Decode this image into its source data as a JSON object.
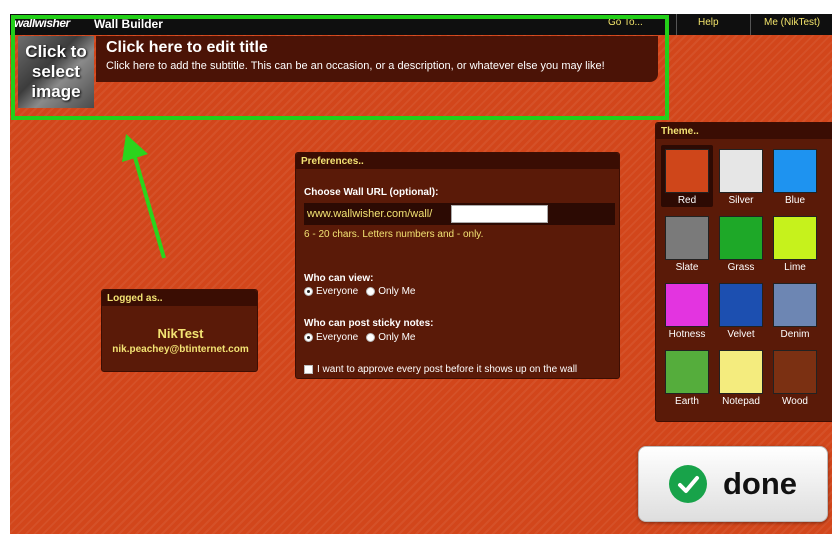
{
  "header": {
    "logo": "wallwisher",
    "app_name": "Wall Builder",
    "nav": {
      "goto": "Go To...",
      "help": "Help",
      "user": "Me (NikTest)"
    }
  },
  "wall": {
    "image_placeholder": [
      "Click to",
      "select",
      "image"
    ],
    "title": "Click here to edit title",
    "subtitle": "Click here to add the subtitle. This can be an occasion, or a description, or whatever else you may like!"
  },
  "logged": {
    "header": "Logged as..",
    "username": "NikTest",
    "email": "nik.peachey@btinternet.com"
  },
  "preferences": {
    "header": "Preferences..",
    "url_label": "Choose Wall URL (optional):",
    "url_prefix": "www.wallwisher.com/wall/",
    "url_value": "",
    "url_hint": "6 - 20 chars. Letters numbers and - only.",
    "view_label": "Who can view:",
    "view_options": [
      "Everyone",
      "Only Me"
    ],
    "view_selected": "Everyone",
    "post_label": "Who can post sticky notes:",
    "post_options": [
      "Everyone",
      "Only Me"
    ],
    "post_selected": "Everyone",
    "approve_label": "I want to approve every post before it shows up on the wall",
    "approve_checked": false
  },
  "theme": {
    "header": "Theme..",
    "selected": "Red",
    "items": [
      {
        "name": "Red",
        "color": "#cf461a"
      },
      {
        "name": "Silver",
        "color": "#e6e6e6"
      },
      {
        "name": "Blue",
        "color": "#1e93f0"
      },
      {
        "name": "Slate",
        "color": "#7a7a7a"
      },
      {
        "name": "Grass",
        "color": "#1ea828"
      },
      {
        "name": "Lime",
        "color": "#c6f21c"
      },
      {
        "name": "Hotness",
        "color": "#e334e0"
      },
      {
        "name": "Velvet",
        "color": "#1c4fb0"
      },
      {
        "name": "Denim",
        "color": "#6d86b3"
      },
      {
        "name": "Earth",
        "color": "#55ad3c"
      },
      {
        "name": "Notepad",
        "color": "#f4ec7e"
      },
      {
        "name": "Wood",
        "color": "#7b3012"
      }
    ]
  },
  "done": {
    "label": "done"
  },
  "colors": {
    "background": "#d2461b",
    "highlight": "#23d019",
    "accent_text": "#f3e373"
  }
}
